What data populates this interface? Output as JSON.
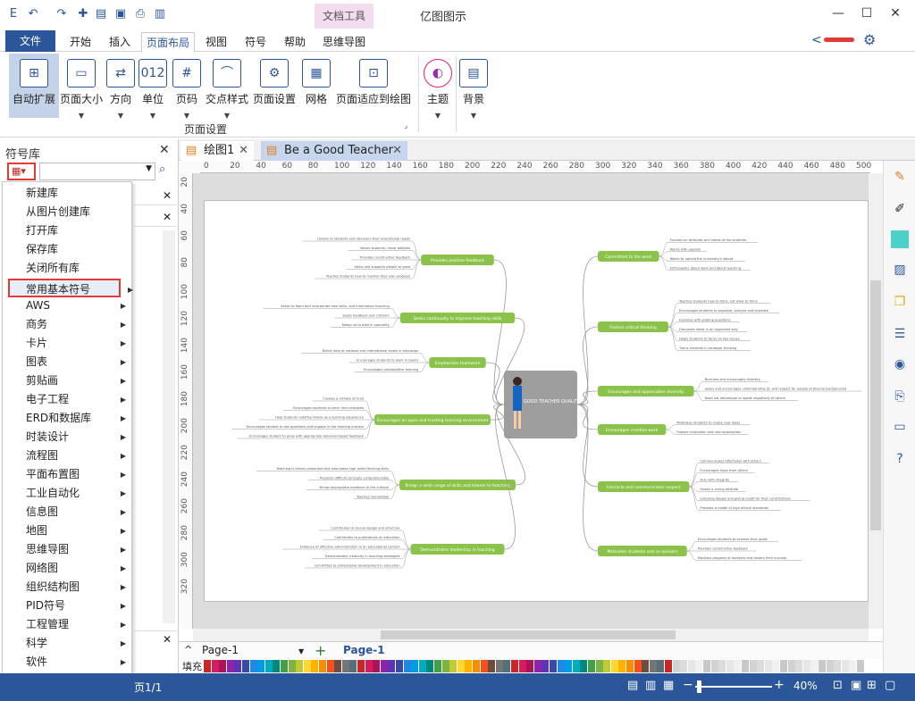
{
  "app_title": "亿图图示",
  "context_tab": "文档工具",
  "window_buttons": [
    "—",
    "☐",
    "✕"
  ],
  "tabs": [
    "文件",
    "开始",
    "插入",
    "页面布局",
    "视图",
    "符号",
    "帮助",
    "思维导图"
  ],
  "ribbon": {
    "buttons": [
      "自动扩展",
      "页面大小",
      "方向",
      "单位",
      "页码",
      "交点样式",
      "页面设置",
      "网格",
      "页面适应到绘图",
      "主题",
      "背景"
    ],
    "group_label": "页面设置"
  },
  "left_panel": {
    "title": "符号库"
  },
  "menu_items": [
    "新建库",
    "从图片创建库",
    "打开库",
    "保存库",
    "关闭所有库",
    "常用基本符号",
    "AWS",
    "商务",
    "卡片",
    "图表",
    "剪贴画",
    "电子工程",
    "ERD和数据库",
    "时装设计",
    "流程图",
    "平面布置图",
    "工业自动化",
    "信息图",
    "地图",
    "思维导图",
    "网络图",
    "组织结构图",
    "PID符号",
    "工程管理",
    "科学",
    "软件",
    "线框图"
  ],
  "doc_tabs": [
    "绘图1",
    "Be a Good Teacher"
  ],
  "ruler_h": [
    "0",
    "20",
    "40",
    "60",
    "80",
    "100",
    "120",
    "140",
    "160",
    "180",
    "200",
    "220",
    "240",
    "260",
    "280",
    "300",
    "320",
    "340",
    "360",
    "380",
    "400",
    "420",
    "440",
    "460",
    "480",
    "500"
  ],
  "ruler_v": [
    "20",
    "40",
    "60",
    "80",
    "100",
    "120",
    "140",
    "160",
    "180",
    "200",
    "220",
    "240",
    "260",
    "280",
    "300",
    "320"
  ],
  "mindmap": {
    "center": "GOOD TEACHER QUALITIES",
    "left": [
      {
        "title": "Provides positive feedback",
        "items": [
          "Listens to students and discovers their educational needs",
          "Values students, never belittles",
          "Provides constructive feedback",
          "Helps and supports people to grow",
          "Teaches students how to monitor their own progress"
        ]
      },
      {
        "title": "Seeks continually to improve teaching skills",
        "items": [
          "Seeks to learn and incorporate new skills, and information teaching",
          "Seeks feedback and criticism",
          "Keeps up to date in speciality"
        ]
      },
      {
        "title": "Emphasizes teamwork",
        "items": [
          "Builds links at national and international levels in education",
          "Encourages students to work in teams",
          "Encourages collaborative learning"
        ]
      },
      {
        "title": "Encourages an open and trusting learning environment",
        "items": [
          "Creates a climate of trust",
          "Encourages students to learn from mistakes",
          "Help students redefine failure as a learning experience",
          "Encourages student to ask questions and engage in the learning process",
          "Encourages student to grow with appropriate behavior-based feedback"
        ]
      },
      {
        "title": "Brings a wide range of skills and talents to teaching",
        "items": [
          "Teaching is clearly presented and stimulates high-order thinking skills",
          "Presents difficult concepts comprehensibly",
          "Brings appropriate evidence to the critique",
          "Teaches memorably"
        ]
      },
      {
        "title": "Demonstrates leadership in teaching",
        "items": [
          "Contributes to course design and structure",
          "Contributes to publications on education",
          "Evidence of effective administration in an educational context",
          "Demonstrates creativity in teaching strategies",
          "Committed to professional development in education"
        ]
      }
    ],
    "right": [
      {
        "title": "Committed to the work",
        "items": [
          "Focuses on attitudes and needs of the students",
          "Works with passion",
          "Wants to uphold the university's values",
          "Enthusiastic about work and about teaching"
        ]
      },
      {
        "title": "Fosters critical thinking",
        "items": [
          "Teaches students how to think, not what to think",
          "Encourages students to organize, analyze and evaluate",
          "Explores with probing questions",
          "Discusses ideas in an organized way",
          "Helps students to focus on key issues",
          "Trains students in strategic thinking"
        ]
      },
      {
        "title": "Encourages and appreciates diversity",
        "items": [
          "Nurtures and encourages diversity",
          "Seeks and encourages understanding of, and respect for people of diverse backgrounds",
          "Does not stereotype or speak negatively of others"
        ]
      },
      {
        "title": "Encourages creative work",
        "items": [
          "Motivates students to create new ideas",
          "Fosters innovation and new approaches"
        ]
      },
      {
        "title": "Interacts and communicates respect",
        "items": [
          "Communicates effectively with others",
          "Encourages input from others",
          "Acts with integrity",
          "Shows a caring attitude",
          "Listening deeply and giving credit for their contributions",
          "Provides a model of high ethical standards"
        ]
      },
      {
        "title": "Motivates students and co-workers",
        "items": [
          "Encourages students to achieve their goals",
          "Provides constructive feedback",
          "Monitors progress of students and fosters their success"
        ]
      }
    ]
  },
  "page_bar": {
    "current": "Page-1",
    "tab": "Page-1",
    "fill_label": "填充"
  },
  "status": {
    "page": "页1/1",
    "zoom": "40%"
  },
  "colors": {
    "accent": "#2b579a",
    "node": "#8bc34a",
    "center": "#9e9e9e",
    "highlight": "#e53935"
  }
}
